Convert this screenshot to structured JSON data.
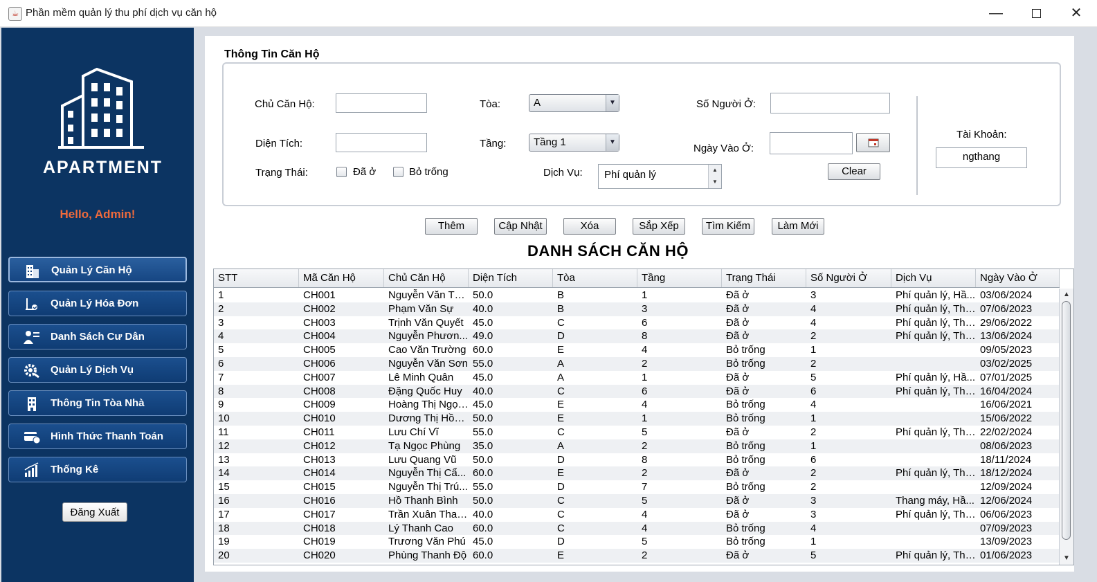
{
  "window": {
    "title": "Phần mềm quản lý thu phí dịch vụ căn hộ",
    "min_glyph": "—",
    "close_glyph": "✕"
  },
  "sidebar": {
    "logo_text": "APARTMENT",
    "greeting": "Hello, Admin!",
    "items": [
      {
        "label": "Quản Lý Căn Hộ",
        "icon": "building-icon"
      },
      {
        "label": "Quản Lý Hóa Đơn",
        "icon": "invoice-icon"
      },
      {
        "label": "Danh Sách Cư Dân",
        "icon": "resident-list-icon"
      },
      {
        "label": "Quản Lý Dịch Vụ",
        "icon": "service-gear-icon"
      },
      {
        "label": "Thông Tin Tòa Nhà",
        "icon": "tower-icon"
      },
      {
        "label": "Hình Thức Thanh Toán",
        "icon": "payment-card-icon"
      },
      {
        "label": "Thống Kê",
        "icon": "stats-chart-icon"
      }
    ],
    "logout_label": "Đăng Xuất"
  },
  "form": {
    "section_title": "Thông Tin Căn Hộ",
    "owner_label": "Chủ Căn Hộ:",
    "owner_value": "",
    "area_label": "Diện Tích:",
    "area_value": "",
    "status_label": "Trạng Thái:",
    "status_opt1": "Đã ở",
    "status_opt2": "Bỏ trống",
    "building_label": "Tòa:",
    "building_value": "A",
    "floor_label": "Tầng:",
    "floor_value": "Tầng 1",
    "service_label": "Dịch Vụ:",
    "service_value": "Phí quản lý",
    "occupants_label": "Số Người Ở:",
    "occupants_value": "",
    "move_in_label": "Ngày Vào Ở:",
    "move_in_value": "",
    "clear_label": "Clear",
    "account_label": "Tài Khoản:",
    "account_value": "ngthang"
  },
  "actions": {
    "add": "Thêm",
    "update": "Cập Nhật",
    "delete": "Xóa",
    "sort": "Sắp Xếp",
    "search": "Tìm Kiếm",
    "refresh": "Làm Mới"
  },
  "table": {
    "title": "DANH SÁCH CĂN HỘ",
    "columns": [
      "STT",
      "Mã Căn Hộ",
      "Chủ Căn Hộ",
      "Diện Tích",
      "Tòa",
      "Tầng",
      "Trạng Thái",
      "Số Người Ở",
      "Dịch Vụ",
      "Ngày Vào Ở"
    ],
    "rows": [
      [
        "1",
        "CH001",
        "Nguyễn Văn Th...",
        "50.0",
        "B",
        "1",
        "Đã ở",
        "3",
        "Phí quản lý, Hầ...",
        "03/06/2024"
      ],
      [
        "2",
        "CH002",
        "Phạm Văn Sự",
        "40.0",
        "B",
        "3",
        "Đã ở",
        "4",
        "Phí quản lý, Tha...",
        "07/06/2023"
      ],
      [
        "3",
        "CH003",
        "Trịnh Văn Quyết",
        "45.0",
        "C",
        "6",
        "Đã ở",
        "4",
        "Phí quản lý, Tha...",
        "29/06/2022"
      ],
      [
        "4",
        "CH004",
        "Nguyễn Phươn...",
        "49.0",
        "D",
        "8",
        "Đã ở",
        "2",
        "Phí quản lý, Tha...",
        "13/06/2024"
      ],
      [
        "5",
        "CH005",
        "Cao Văn Trường",
        "60.0",
        "E",
        "4",
        "Bỏ trống",
        "1",
        "",
        "09/05/2023"
      ],
      [
        "6",
        "CH006",
        "Nguyễn Văn Sơn",
        "55.0",
        "A",
        "2",
        "Bỏ trống",
        "2",
        "",
        "03/02/2025"
      ],
      [
        "7",
        "CH007",
        "Lê Minh Quân",
        "45.0",
        "A",
        "1",
        "Đã ở",
        "5",
        "Phí quản lý, Hầ...",
        "07/01/2025"
      ],
      [
        "8",
        "CH008",
        "Đặng Quốc Huy",
        "40.0",
        "C",
        "6",
        "Đã ở",
        "6",
        "Phí quản lý, Tha...",
        "16/04/2024"
      ],
      [
        "9",
        "CH009",
        "Hoàng Thị Ngọc...",
        "45.0",
        "E",
        "4",
        "Bỏ trống",
        "4",
        "",
        "16/06/2021"
      ],
      [
        "10",
        "CH010",
        "Dương Thị Hồn...",
        "50.0",
        "E",
        "1",
        "Bỏ trống",
        "1",
        "",
        "15/06/2022"
      ],
      [
        "11",
        "CH011",
        "Lưu Chí Vĩ",
        "55.0",
        "C",
        "5",
        "Đã ở",
        "2",
        "Phí quản lý, Tha...",
        "22/02/2024"
      ],
      [
        "12",
        "CH012",
        "Tạ Ngọc Phùng",
        "35.0",
        "A",
        "2",
        "Bỏ trống",
        "1",
        "",
        "08/06/2023"
      ],
      [
        "13",
        "CH013",
        "Lưu Quang Vũ",
        "50.0",
        "D",
        "8",
        "Bỏ trống",
        "6",
        "",
        "18/11/2024"
      ],
      [
        "14",
        "CH014",
        "Nguyễn Thị Cẩ...",
        "60.0",
        "E",
        "2",
        "Đã ở",
        "2",
        "Phí quản lý, Tha...",
        "18/12/2024"
      ],
      [
        "15",
        "CH015",
        "Nguyễn Thị Trú...",
        "55.0",
        "D",
        "7",
        "Bỏ trống",
        "2",
        "",
        "12/09/2024"
      ],
      [
        "16",
        "CH016",
        "Hồ Thanh Bình",
        "50.0",
        "C",
        "5",
        "Đã ở",
        "3",
        "Thang máy, Hầ...",
        "12/06/2024"
      ],
      [
        "17",
        "CH017",
        "Trần Xuân Than...",
        "40.0",
        "C",
        "4",
        "Đã ở",
        "3",
        "Phí quản lý, Tha...",
        "06/06/2023"
      ],
      [
        "18",
        "CH018",
        "Lý Thanh Cao",
        "60.0",
        "C",
        "4",
        "Bỏ trống",
        "4",
        "",
        "07/09/2023"
      ],
      [
        "19",
        "CH019",
        "Trương Văn Phú",
        "45.0",
        "D",
        "5",
        "Bỏ trống",
        "1",
        "",
        "13/09/2023"
      ],
      [
        "20",
        "CH020",
        "Phùng Thanh Độ",
        "60.0",
        "E",
        "2",
        "Đã ở",
        "5",
        "Phí quản lý, Tha...",
        "01/06/2023"
      ]
    ]
  },
  "colors": {
    "sidebar_bg": "#0c3462",
    "greeting": "#ef6a3c"
  }
}
